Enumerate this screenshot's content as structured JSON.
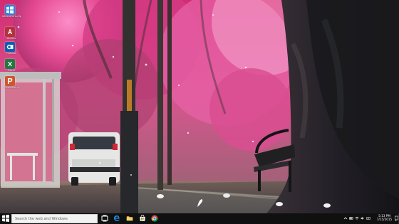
{
  "desktop": {
    "icons": [
      {
        "label": "Welcome to Windows",
        "icon": "windows-icon",
        "color": "#0f8be8"
      },
      {
        "label": "Access",
        "icon": "access-icon",
        "color": "#b5313b"
      },
      {
        "label": "Outlook",
        "icon": "outlook-icon",
        "color": "#0e5fb4"
      },
      {
        "label": "Excel",
        "icon": "excel-icon",
        "color": "#1f7a42"
      },
      {
        "label": "PowerPoint",
        "icon": "powerpoint-icon",
        "color": "#d1552d"
      }
    ]
  },
  "taskbar": {
    "search_placeholder": "Search the web and Windows",
    "clock_time": "5:13 PM",
    "clock_date": "7/15/2015",
    "icons": {
      "start": "windows-start-icon",
      "task_view": "task-view-icon",
      "edge": "edge-icon",
      "explorer": "file-explorer-icon",
      "store": "store-icon",
      "chrome": "chrome-icon",
      "tray_up": "chevron-up-icon",
      "battery": "battery-icon",
      "wifi": "wifi-icon",
      "volume": "volume-icon",
      "language": "language-icon",
      "action_center": "notification-icon"
    }
  },
  "colors": {
    "taskbar": "#101010",
    "search_box": "#f2f2f2",
    "blossom_pink": "#e83f86",
    "accent_blue": "#0f8be8"
  }
}
